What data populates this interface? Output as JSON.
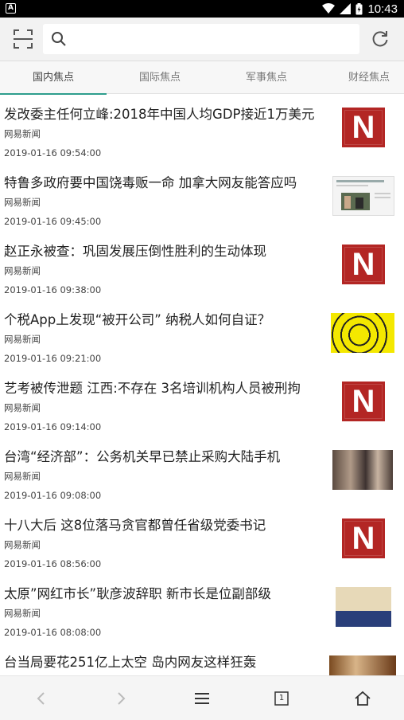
{
  "status_bar": {
    "time": "10:43",
    "notification_icon": "A",
    "icons": [
      "wifi-icon",
      "signal-icon",
      "battery-icon"
    ]
  },
  "search": {
    "value": "",
    "placeholder": ""
  },
  "tabs": [
    {
      "label": "国内焦点",
      "active": true
    },
    {
      "label": "国际焦点",
      "active": false
    },
    {
      "label": "军事焦点",
      "active": false
    },
    {
      "label": "财经焦点",
      "active": false
    }
  ],
  "news": [
    {
      "title": "发改委主任何立峰:2018年中国人均GDP接近1万美元",
      "source": "网易新闻",
      "time": "2019-01-16 09:54:00",
      "thumb": "netease-logo"
    },
    {
      "title": "特鲁多政府要中国饶毒贩一命 加拿大网友能答应吗",
      "source": "网易新闻",
      "time": "2019-01-16 09:45:00",
      "thumb": "webpage-screenshot"
    },
    {
      "title": "赵正永被查：巩固发展压倒性胜利的生动体现",
      "source": "网易新闻",
      "time": "2019-01-16 09:38:00",
      "thumb": "netease-logo"
    },
    {
      "title": "个税App上发现“被开公司” 纳税人如何自证？",
      "source": "网易新闻",
      "time": "2019-01-16 09:21:00",
      "thumb": "tax-target"
    },
    {
      "title": "艺考被传泄题 江西:不存在 3名培训机构人员被刑拘",
      "source": "网易新闻",
      "time": "2019-01-16 09:14:00",
      "thumb": "netease-logo"
    },
    {
      "title": "台湾“经济部”：公务机关早已禁止采购大陆手机",
      "source": "网易新闻",
      "time": "2019-01-16 09:08:00",
      "thumb": "photo-crowd"
    },
    {
      "title": "十八大后 这8位落马贪官都曾任省级党委书记",
      "source": "网易新闻",
      "time": "2019-01-16 08:56:00",
      "thumb": "netease-logo"
    },
    {
      "title": "太原”网红市长”耿彦波辞职 新市长是位副部级",
      "source": "网易新闻",
      "time": "2019-01-16 08:08:00",
      "thumb": "photo-official"
    },
    {
      "title": "台当局要花251亿上太空 岛内网友这样狂轰",
      "source": "",
      "time": "",
      "thumb": "photo-partial"
    }
  ],
  "netease_letter": "N",
  "bottom_nav": {
    "tab_count": "1"
  },
  "colors": {
    "accent": "#2e9d8d",
    "netease_red": "#b32624"
  }
}
